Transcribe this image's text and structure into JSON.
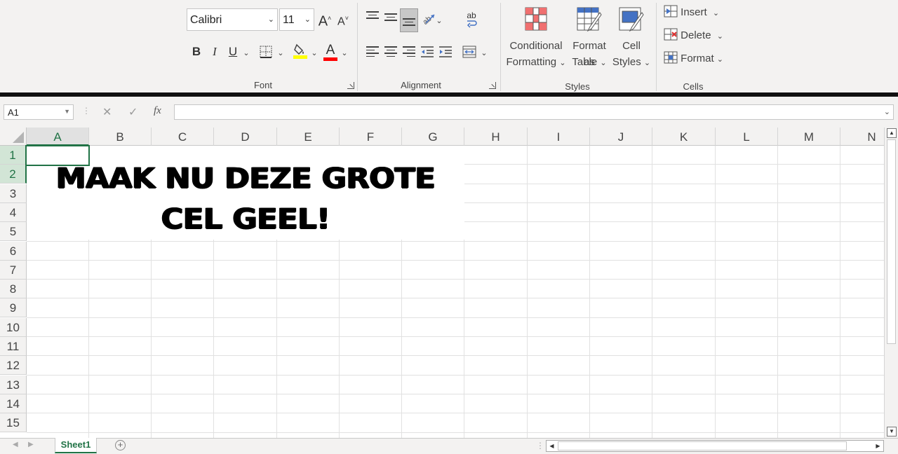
{
  "ribbon": {
    "font": {
      "font_name": "Calibri",
      "font_size": "11",
      "grow_font": "A",
      "shrink_font": "A",
      "bold": "B",
      "italic": "I",
      "underline": "U",
      "font_color_letter": "A",
      "group_label": "Font",
      "fill_color": "#ffff00",
      "font_color": "#ff0000"
    },
    "alignment": {
      "group_label": "Alignment",
      "wrap_text_glyph": "ab"
    },
    "styles": {
      "group_label": "Styles",
      "conditional_formatting": [
        "Conditional",
        "Formatting"
      ],
      "format_as_table": [
        "Format as",
        "Table"
      ],
      "cell_styles": [
        "Cell",
        "Styles"
      ]
    },
    "cells": {
      "group_label": "Cells",
      "insert": "Insert",
      "delete": "Delete",
      "format": "Format"
    }
  },
  "formula_bar": {
    "name_box": "A1",
    "fx": "fx",
    "formula": ""
  },
  "grid": {
    "columns": [
      "A",
      "B",
      "C",
      "D",
      "E",
      "F",
      "G",
      "H",
      "I",
      "J",
      "K",
      "L",
      "M",
      "N"
    ],
    "rows": [
      "1",
      "2",
      "3",
      "4",
      "5",
      "6",
      "7",
      "8",
      "9",
      "10",
      "11",
      "12",
      "13",
      "14",
      "15"
    ],
    "selected_cell": "A1",
    "merged_text": [
      "MAAK NU DEZE GROTE",
      "CEL GEEL!"
    ]
  },
  "sheets": {
    "tabs": [
      "Sheet1"
    ],
    "active": "Sheet1"
  },
  "colors": {
    "accent": "#217346",
    "ribbon_bg": "#f3f2f1"
  }
}
